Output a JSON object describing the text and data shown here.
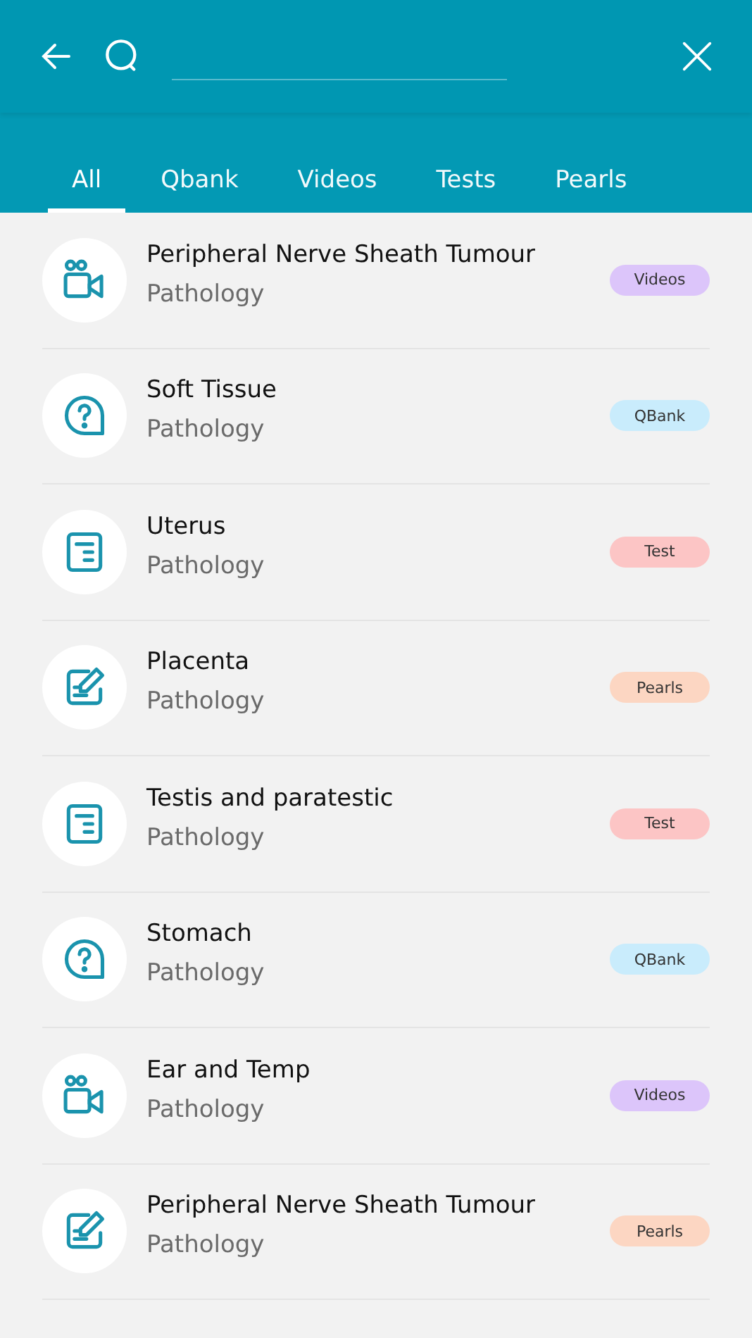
{
  "tabs": [
    {
      "label": "All",
      "selected": true
    },
    {
      "label": "Qbank",
      "selected": false
    },
    {
      "label": "Videos",
      "selected": false
    },
    {
      "label": "Tests",
      "selected": false
    },
    {
      "label": "Pearls",
      "selected": false
    }
  ],
  "results": [
    {
      "kind": "video",
      "title": "Peripheral Nerve Sheath Tumour",
      "subtitle": "Pathology",
      "badge": "Videos"
    },
    {
      "kind": "qbank",
      "title": "Soft Tissue",
      "subtitle": "Pathology",
      "badge": "QBank"
    },
    {
      "kind": "test",
      "title": "Uterus",
      "subtitle": "Pathology",
      "badge": "Test"
    },
    {
      "kind": "pearls",
      "title": "Placenta",
      "subtitle": "Pathology",
      "badge": "Pearls"
    },
    {
      "kind": "test",
      "title": "Testis and paratestic",
      "subtitle": "Pathology",
      "badge": "Test"
    },
    {
      "kind": "qbank",
      "title": "Stomach",
      "subtitle": "Pathology",
      "badge": "QBank"
    },
    {
      "kind": "video",
      "title": "Ear and Temp",
      "subtitle": "Pathology",
      "badge": "Videos"
    },
    {
      "kind": "pearls",
      "title": "Peripheral Nerve Sheath Tumour",
      "subtitle": "Pathology",
      "badge": "Pearls"
    }
  ]
}
